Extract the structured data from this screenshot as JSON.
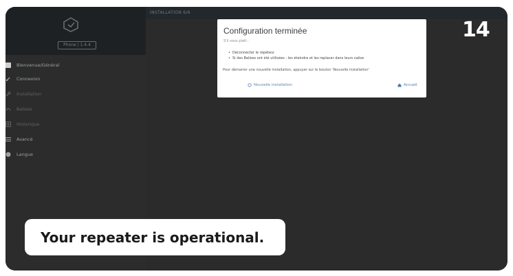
{
  "sidebar": {
    "version": "Phone | 1.4.4",
    "items": [
      {
        "label": "Bienvenue/Général",
        "icon": "square-icon",
        "dim": false
      },
      {
        "label": "Connexion",
        "icon": "link-icon",
        "dim": false
      },
      {
        "label": "Installation",
        "icon": "wrench-icon",
        "dim": true
      },
      {
        "label": "Balises",
        "icon": "beacon-icon",
        "dim": true
      },
      {
        "label": "Historique",
        "icon": "grid-icon",
        "dim": true
      },
      {
        "label": "Avancé",
        "icon": "list-icon",
        "dim": false
      },
      {
        "label": "Langue",
        "icon": "globe-icon",
        "dim": false
      }
    ]
  },
  "topbar": {
    "title": "INSTALLATION 6/6"
  },
  "dialog": {
    "title": "Configuration terminée",
    "subtitle": "S'il vous plaît :",
    "bullets": [
      "Déconnecter le répéteur",
      "Si des Balises ont été utilisées : les éteindre et les replacer dans leurs valise"
    ],
    "note": "Pour démarrer une nouvelle installation, appuyer sur le bouton 'Nouvelle installation'",
    "new_install_label": "Nouvelle installation",
    "home_label": "Accueil"
  },
  "step_number": "14",
  "caption": "Your repeater is operational.",
  "colors": {
    "frame_bg": "#2a2a2a",
    "dialog_bg": "#ffffff",
    "link_blue": "#4b7bb5"
  }
}
